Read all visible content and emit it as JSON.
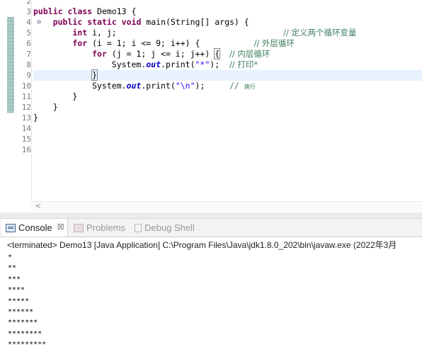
{
  "editor": {
    "line_numbers": [
      "2",
      "3",
      "4",
      "5",
      "6",
      "7",
      "8",
      "9",
      "10",
      "11",
      "12",
      "13",
      "14",
      "15",
      "16"
    ],
    "fold_toggle": "⊖",
    "lines": [
      [],
      [
        {
          "t": "public",
          "c": "kw"
        },
        {
          "t": " "
        },
        {
          "t": "class",
          "c": "kw"
        },
        {
          "t": " Demo13 {"
        }
      ],
      [
        {
          "t": "    "
        },
        {
          "t": "public",
          "c": "kw"
        },
        {
          "t": " "
        },
        {
          "t": "static",
          "c": "kw"
        },
        {
          "t": " "
        },
        {
          "t": "void",
          "c": "kw"
        },
        {
          "t": " main(String[] args) {"
        }
      ],
      [
        {
          "t": "        "
        },
        {
          "t": "int",
          "c": "kw"
        },
        {
          "t": " i, j;                                  "
        },
        {
          "t": "// 定义两个循环变量",
          "c": "cmt-cjk"
        }
      ],
      [
        {
          "t": "        "
        },
        {
          "t": "for",
          "c": "kw"
        },
        {
          "t": " (i = 1; i <= 9; i++) {           "
        },
        {
          "t": "// 外层循环",
          "c": "cmt-cjk"
        }
      ],
      [
        {
          "t": "            "
        },
        {
          "t": "for",
          "c": "kw"
        },
        {
          "t": " (j = 1; j <= i; j++) "
        },
        {
          "t": "{",
          "c": "bracket-box"
        },
        {
          "t": "  "
        },
        {
          "t": "// 内层循环",
          "c": "cmt-cjk"
        }
      ],
      [
        {
          "t": "                System."
        },
        {
          "t": "out",
          "c": "fld"
        },
        {
          "t": ".print("
        },
        {
          "t": "\"*\"",
          "c": "str"
        },
        {
          "t": ");  "
        },
        {
          "t": "// 打印*",
          "c": "cmt-cjk"
        }
      ],
      [
        {
          "t": "            "
        },
        {
          "t": "}",
          "c": "bracket-box"
        }
      ],
      [
        {
          "t": "            System."
        },
        {
          "t": "out",
          "c": "fld"
        },
        {
          "t": ".print("
        },
        {
          "t": "\"\\n\"",
          "c": "str"
        },
        {
          "t": ");     "
        },
        {
          "t": "// ",
          "c": "cmt"
        },
        {
          "t": "换行",
          "c": "cmt-small"
        }
      ],
      [
        {
          "t": "        }"
        }
      ],
      [
        {
          "t": "    }"
        }
      ],
      [
        {
          "t": "}"
        }
      ],
      [],
      [],
      []
    ]
  },
  "console": {
    "tabs": [
      {
        "label": "Console",
        "icon": "console-icon",
        "active": true,
        "closable": true
      },
      {
        "label": "Problems",
        "icon": "problems-icon",
        "active": false,
        "closable": false
      },
      {
        "label": "Debug Shell",
        "icon": "debug-shell-icon",
        "active": false,
        "closable": false
      }
    ],
    "close_glyph": "☒",
    "status": "<terminated> Demo13 [Java Application] C:\\Program Files\\Java\\jdk1.8.0_202\\bin\\javaw.exe (2022年3月",
    "output_lines": [
      "*",
      "**",
      "***",
      "****",
      "*****",
      "******",
      "*******",
      "********",
      "*********"
    ]
  },
  "scroll_arrow": "<"
}
